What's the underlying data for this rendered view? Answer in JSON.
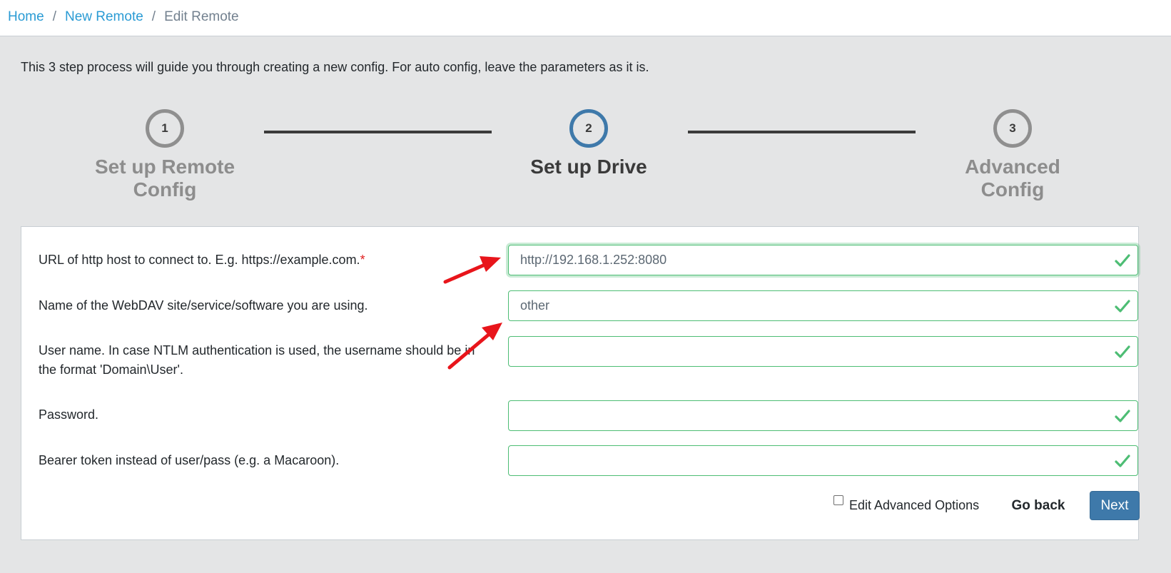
{
  "breadcrumb": {
    "items": [
      "Home",
      "New Remote"
    ],
    "separator": "/",
    "current": "Edit Remote"
  },
  "intro": "This 3 step process will guide you through creating a new config. For auto config, leave the parameters as it is.",
  "stepper": {
    "steps": [
      {
        "number": "1",
        "label_line1": "Set up Remote",
        "label_line2": "Config"
      },
      {
        "number": "2",
        "label_line1": "Set up Drive",
        "label_line2": ""
      },
      {
        "number": "3",
        "label_line1": "Advanced",
        "label_line2": "Config"
      }
    ]
  },
  "form": {
    "fields": [
      {
        "label": "URL of http host to connect to. E.g. https://example.com.",
        "required_mark": "*",
        "value": "http://192.168.1.252:8080"
      },
      {
        "label": "Name of the WebDAV site/service/software you are using.",
        "value": "other"
      },
      {
        "label": "User name. In case NTLM authentication is used, the username should be in the format 'Domain\\User'.",
        "value": ""
      },
      {
        "label": "Password.",
        "value": ""
      },
      {
        "label": "Bearer token instead of user/pass (e.g. a Macaroon).",
        "value": ""
      }
    ]
  },
  "actions": {
    "advanced_label": "Edit Advanced Options",
    "back_label": "Go back",
    "next_label": "Next"
  },
  "colors": {
    "link": "#2a9bd4",
    "success": "#4dbd74",
    "primary": "#3e79aa",
    "annotation_arrow": "#e8151b"
  }
}
